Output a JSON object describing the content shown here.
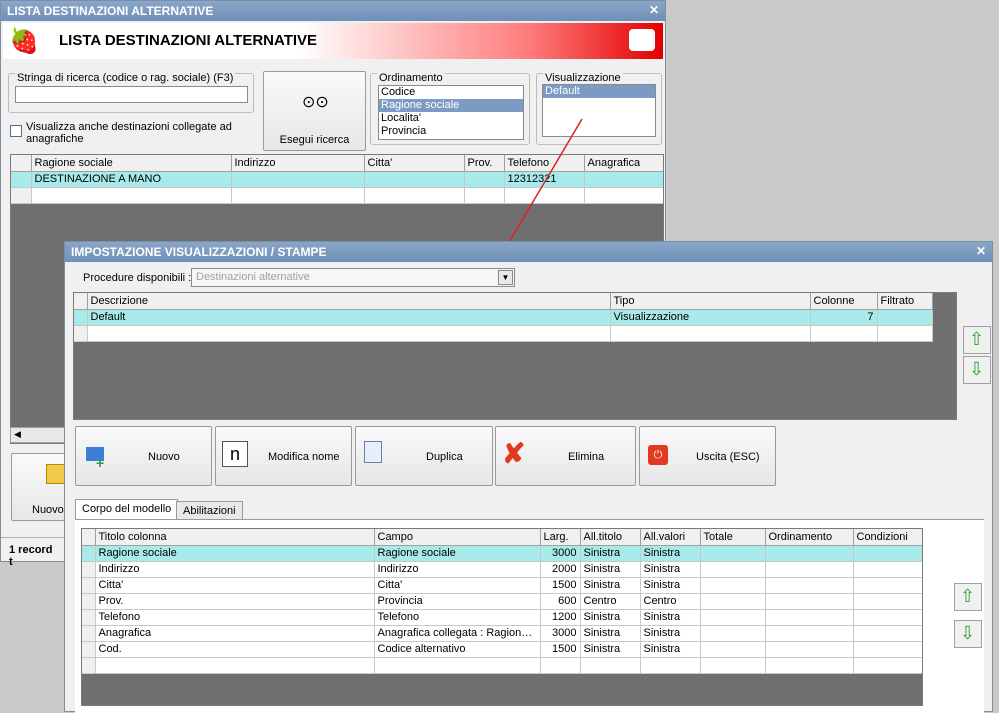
{
  "win1": {
    "title": "LISTA DESTINAZIONI ALTERNATIVE",
    "banner": "LISTA DESTINAZIONI ALTERNATIVE",
    "search_label": "Stringa di ricerca (codice o rag. sociale) (F3)",
    "search_value": "",
    "linked_checkbox": "Visualizza anche destinazioni collegate ad anagrafiche",
    "search_button": "Esegui ricerca",
    "ordering_label": "Ordinamento",
    "ordering_options": [
      "Codice",
      "Ragione sociale",
      "Localita'",
      "Provincia"
    ],
    "ordering_selected": 1,
    "view_label": "Visualizzazione",
    "view_options": [
      "Default"
    ],
    "columns": [
      "Ragione sociale",
      "Indirizzo",
      "Citta'",
      "Prov.",
      "Telefono",
      "Anagrafica"
    ],
    "rows": [
      [
        "DESTINAZIONE A MANO",
        "",
        "",
        "",
        "12312321",
        ""
      ]
    ],
    "new_button": "Nuovo",
    "status": "1 record t"
  },
  "win2": {
    "title": "IMPOSTAZIONE VISUALIZZAZIONI / STAMPE",
    "proc_label": "Procedure disponibili :",
    "proc_value": "Destinazioni alternative",
    "columns": [
      "Descrizione",
      "Tipo",
      "Colonne",
      "Filtrato"
    ],
    "rows": [
      [
        "Default",
        "Visualizzazione",
        "7",
        ""
      ]
    ],
    "buttons": {
      "new": "Nuovo",
      "rename": "Modifica nome",
      "dup": "Duplica",
      "del": "Elimina",
      "exit": "Uscita (ESC)"
    },
    "tabs": [
      "Corpo del modello",
      "Abilitazioni"
    ],
    "body_columns": [
      "Titolo colonna",
      "Campo",
      "Larg.",
      "All.titolo",
      "All.valori",
      "Totale",
      "Ordinamento",
      "Condizioni"
    ],
    "body_rows": [
      [
        "Ragione sociale",
        "Ragione sociale",
        "3000",
        "Sinistra",
        "Sinistra",
        "",
        "",
        ""
      ],
      [
        "Indirizzo",
        "Indirizzo",
        "2000",
        "Sinistra",
        "Sinistra",
        "",
        "",
        ""
      ],
      [
        "Citta'",
        "Citta'",
        "1500",
        "Sinistra",
        "Sinistra",
        "",
        "",
        ""
      ],
      [
        "Prov.",
        "Provincia",
        "600",
        "Centro",
        "Centro",
        "",
        "",
        ""
      ],
      [
        "Telefono",
        "Telefono",
        "1200",
        "Sinistra",
        "Sinistra",
        "",
        "",
        ""
      ],
      [
        "Anagrafica",
        "Anagrafica collegata : Ragione sociale",
        "3000",
        "Sinistra",
        "Sinistra",
        "",
        "",
        ""
      ],
      [
        "Cod.",
        "Codice alternativo",
        "1500",
        "Sinistra",
        "Sinistra",
        "",
        "",
        ""
      ]
    ]
  },
  "colors": {
    "accent": "#e20000",
    "selection": "#a8eaea",
    "titlebar": "#7f9cc2"
  }
}
